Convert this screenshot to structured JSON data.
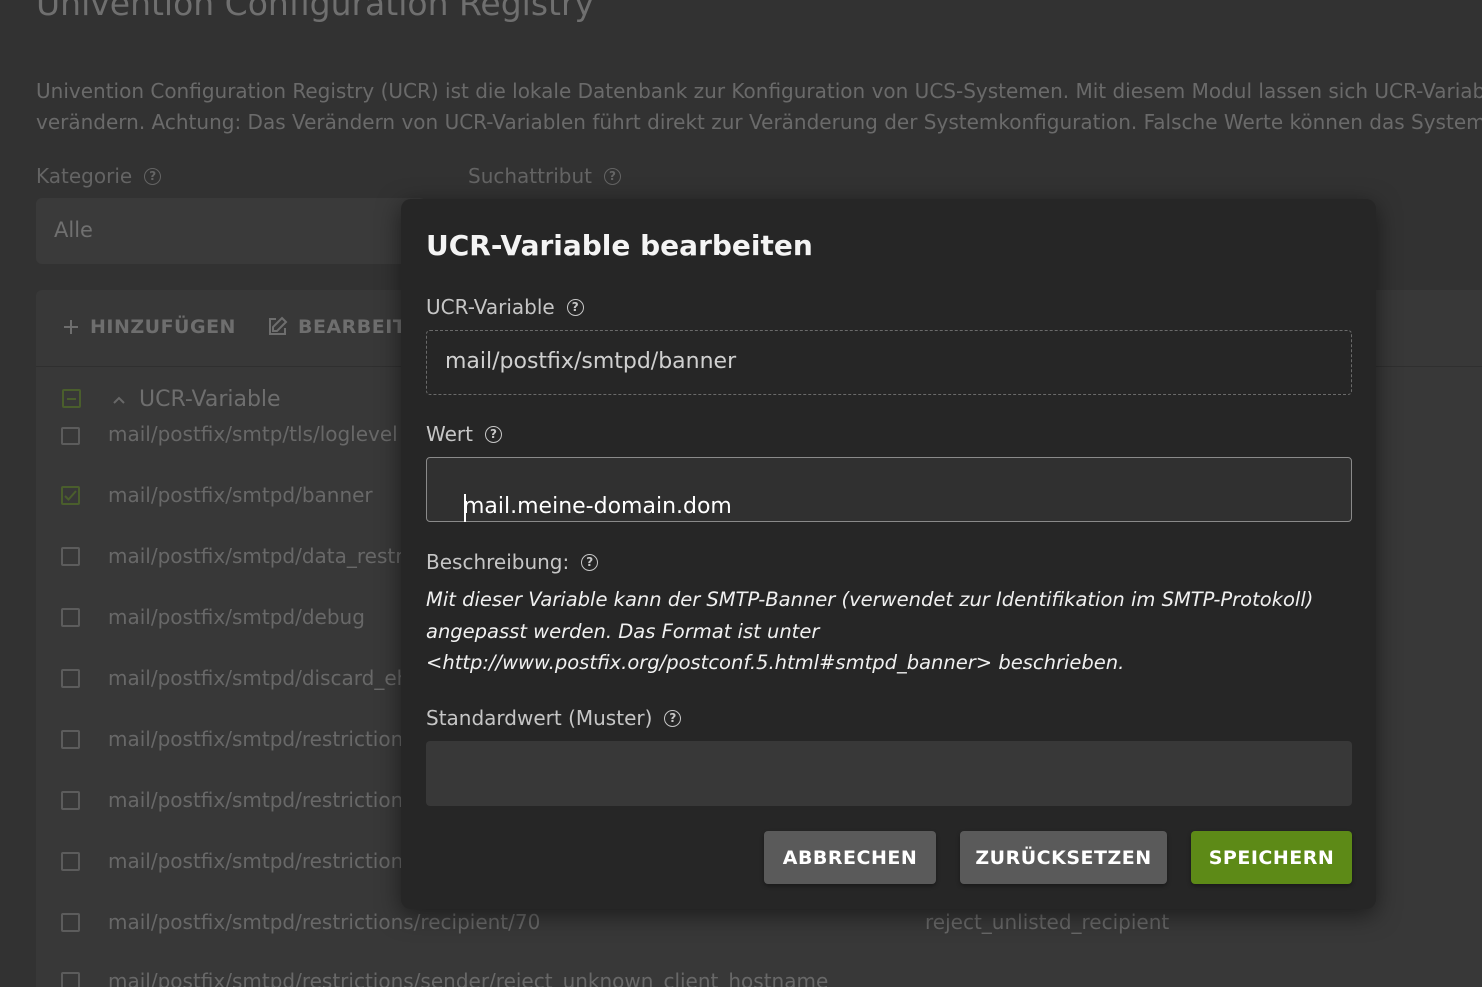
{
  "background": {
    "title": "Univention Configuration Registry",
    "description_line1": "Univention Configuration Registry (UCR) ist die lokale Datenbank zur Konfiguration von UCS-Systemen. Mit diesem Modul lassen sich UCR-Variablen",
    "description_line2": "verändern. Achtung: Das Verändern von UCR-Variablen führt direkt zur Veränderung der Systemkonfiguration. Falsche Werte können das System un",
    "category_label": "Kategorie",
    "search_attr_label": "Suchattribut",
    "category_value": "Alle",
    "toolbar": {
      "add_label": "HINZUFÜGEN",
      "edit_label": "BEARBEITEN"
    },
    "column_header": "UCR-Variable",
    "rows": [
      {
        "name": "mail/postfix/smtp/tls/loglevel",
        "value": ""
      },
      {
        "name": "mail/postfix/smtpd/banner",
        "value": ""
      },
      {
        "name": "mail/postfix/smtpd/data_restrictions",
        "value": ""
      },
      {
        "name": "mail/postfix/smtpd/debug",
        "value": ""
      },
      {
        "name": "mail/postfix/smtpd/discard_ehlo_keywords",
        "value": ""
      },
      {
        "name": "mail/postfix/smtpd/restrictions",
        "value": ""
      },
      {
        "name": "mail/postfix/smtpd/restrictions",
        "value": ""
      },
      {
        "name": "mail/postfix/smtpd/restrictions",
        "value": ""
      },
      {
        "name": "mail/postfix/smtpd/restrictions/recipient/70",
        "value": "reject_unlisted_recipient"
      },
      {
        "name": "mail/postfix/smtpd/restrictions/sender/reject_unknown_client_hostname",
        "value": ""
      }
    ]
  },
  "dialog": {
    "title": "UCR-Variable bearbeiten",
    "variable_label": "UCR-Variable",
    "variable_value": "mail/postfix/smtpd/banner",
    "value_label": "Wert",
    "value_value": "mail.meine-domain.dom",
    "description_label": "Beschreibung:",
    "description_text": "Mit dieser Variable kann der SMTP-Banner (verwendet zur Identifikation im SMTP-Protokoll) angepasst werden. Das Format ist unter <http://www.postfix.org/postconf.5.html#smtpd_banner> beschrieben.",
    "default_label": "Standardwert (Muster)",
    "default_value": "",
    "buttons": {
      "cancel": "ABBRECHEN",
      "reset": "ZURÜCKSETZEN",
      "save": "SPEICHERN"
    }
  },
  "colors": {
    "accent_green": "#5d8a17",
    "button_grey": "#5a5a5a",
    "dialog_bg": "#262626"
  },
  "icons": {
    "help": "help-circle-icon",
    "add": "plus-icon",
    "edit": "edit-icon",
    "sort": "chevron-up-icon"
  }
}
